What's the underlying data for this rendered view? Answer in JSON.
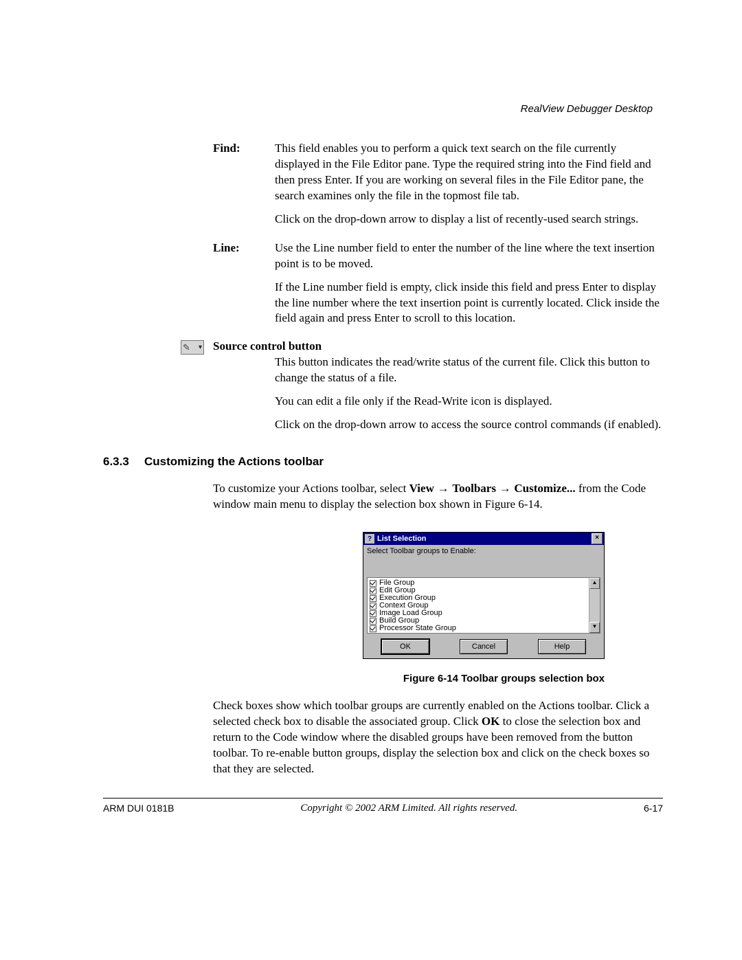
{
  "header": {
    "running_title": "RealView Debugger Desktop"
  },
  "defs": {
    "find": {
      "label": "Find:",
      "p1": "This field enables you to perform a quick text search on the file currently displayed in the File Editor pane. Type the required string into the Find field and then press Enter. If you are working on several files in the File Editor pane, the search examines only the file in the topmost file tab.",
      "p2": "Click on the drop-down arrow to display a list of recently-used search strings."
    },
    "line": {
      "label": "Line:",
      "p1": "Use the Line number field to enter the number of the line where the text insertion point is to be moved.",
      "p2": "If the Line number field is empty, click inside this field and press Enter to display the line number where the text insertion point is currently located. Click inside the field again and press Enter to scroll to this location."
    }
  },
  "scb": {
    "title": "Source control button",
    "p1": "This button indicates the read/write status of the current file. Click this button to change the status of a file.",
    "p2": "You can edit a file only if the Read-Write icon is displayed.",
    "p3": "Click on the drop-down arrow to access the source control commands (if enabled)."
  },
  "section": {
    "number": "6.3.3",
    "title": "Customizing the Actions toolbar",
    "intro_pre": "To customize your Actions toolbar, select ",
    "menu1": "View",
    "menu2": "Toolbars",
    "menu3": "Customize...",
    "intro_post": " from the Code window main menu to display the selection box shown in Figure 6-14."
  },
  "dialog": {
    "title": "List Selection",
    "prompt": "Select Toolbar groups to Enable:",
    "items": [
      "File Group",
      "Edit Group",
      "Execution Group",
      "Context Group",
      "Image Load Group",
      "Build Group",
      "Processor State Group"
    ],
    "ok": "OK",
    "cancel": "Cancel",
    "help": "Help"
  },
  "figure_caption": "Figure 6-14 Toolbar groups selection box",
  "after_fig_pre": "Check boxes show which toolbar groups are currently enabled on the Actions toolbar. Click a selected check box to disable the associated group. Click ",
  "after_fig_ok": "OK",
  "after_fig_post": " to close the selection box and return to the Code window where the disabled groups have been removed from the button toolbar. To re-enable button groups, display the selection box and click on the check boxes so that they are selected.",
  "footer": {
    "left": "ARM DUI 0181B",
    "center": "Copyright © 2002 ARM Limited. All rights reserved.",
    "right": "6-17"
  }
}
